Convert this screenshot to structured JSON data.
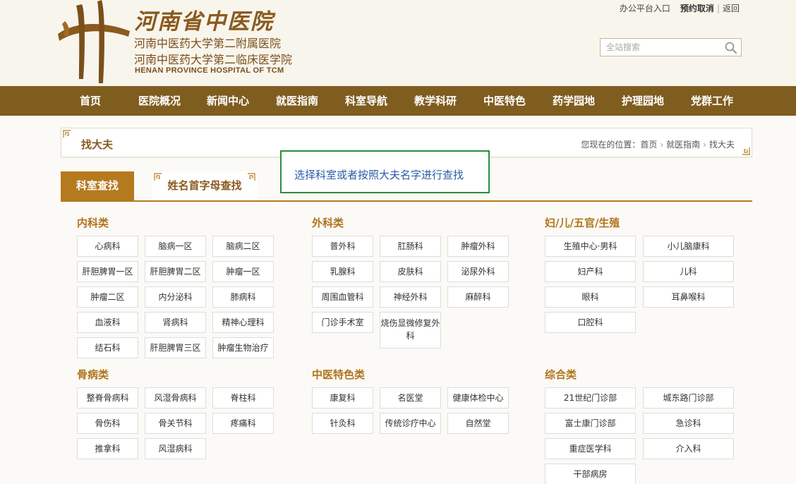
{
  "header": {
    "logo_title": "河南省中医院",
    "logo_sub1": "河南中医药大学第二附属医院",
    "logo_sub2": "河南中医药大学第二临床医学院",
    "logo_en": "HENAN PROVINCE HOSPITAL OF TCM",
    "top_links": {
      "office": "办公平台入口",
      "appointment_cancel": "预约取消",
      "back": "返回"
    },
    "search": {
      "placeholder": "全站搜索"
    }
  },
  "nav": {
    "items": [
      "首页",
      "医院概况",
      "新闻中心",
      "就医指南",
      "科室导航",
      "教学科研",
      "中医特色",
      "药学园地",
      "护理园地",
      "党群工作"
    ]
  },
  "title_bar": {
    "title": "找大夫",
    "breadcrumb_prefix": "您现在的位置：",
    "crumbs": [
      "首页",
      "就医指南",
      "找大夫"
    ]
  },
  "hint": "选择科室或者按照大夫名字进行查找",
  "tabs": {
    "dept": "科室查找",
    "name": "姓名首字母查找"
  },
  "categories": {
    "internal": {
      "title": "内科类",
      "items": [
        "心病科",
        "脑病一区",
        "脑病二区",
        "肝胆脾胃一区",
        "肝胆脾胃二区",
        "肿瘤一区",
        "肿瘤二区",
        "内分泌科",
        "肺病科",
        "血液科",
        "肾病科",
        "精神心理科",
        "结石科",
        "肝胆脾胃三区",
        "肿瘤生物治疗"
      ]
    },
    "surgery": {
      "title": "外科类",
      "items": [
        "普外科",
        "肛肠科",
        "肿瘤外科",
        "乳腺科",
        "皮肤科",
        "泌尿外科",
        "周围血管科",
        "神经外科",
        "麻醉科",
        "门诊手术室",
        "烧伤显微修复外科"
      ]
    },
    "women": {
      "title": "妇/儿/五官/生殖",
      "items": [
        "生殖中心·男科",
        "小儿脑康科",
        "妇产科",
        "儿科",
        "眼科",
        "耳鼻喉科",
        "口腔科"
      ]
    },
    "bone": {
      "title": "骨病类",
      "items": [
        "整脊骨病科",
        "风湿骨病科",
        "脊柱科",
        "骨伤科",
        "骨关节科",
        "疼痛科",
        "推拿科",
        "风湿病科"
      ]
    },
    "tcm": {
      "title": "中医特色类",
      "items": [
        "康复科",
        "名医堂",
        "健康体检中心",
        "针灸科",
        "传统诊疗中心",
        "自然堂"
      ]
    },
    "general": {
      "title": "综合类",
      "items": [
        "21世纪门诊部",
        "城东路门诊部",
        "富士康门诊部",
        "急诊科",
        "重症医学科",
        "介入科",
        "干部病房"
      ]
    }
  },
  "colors": {
    "nav_bg": "#7f5d1f",
    "accent": "#b57a1e",
    "hint_border": "#2e8b3d",
    "hint_text": "#2b5ca8"
  }
}
